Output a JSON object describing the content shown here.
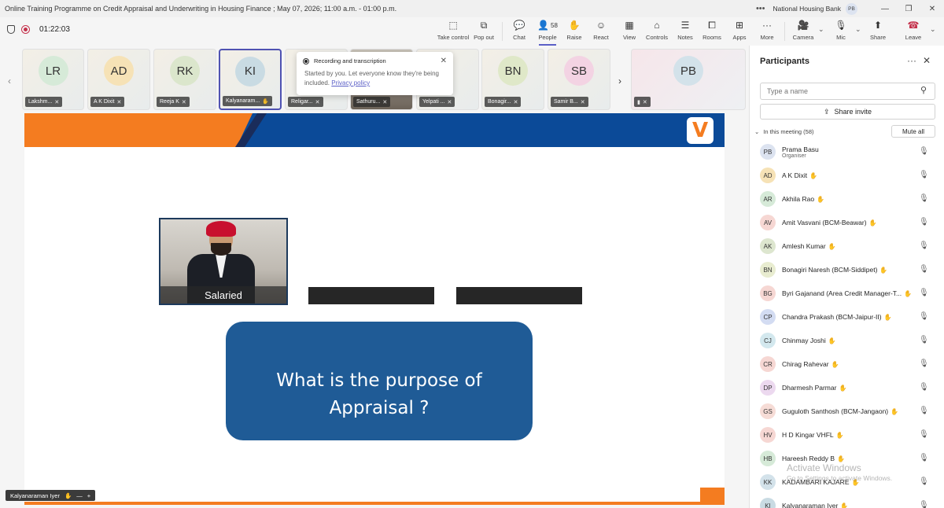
{
  "window": {
    "title": "Online Training Programme on Credit Appraisal and Underwriting in Housing Finance ; May 07, 2026; 11:00 a.m. - 01:00 p.m.",
    "org": "National Housing Bank",
    "user_initials": "PB",
    "more_glyph": "•••",
    "minimize": "—",
    "restore": "❐",
    "close": "✕"
  },
  "toolbar": {
    "timer": "01:22:03",
    "take_control": "Take control",
    "pop_out": "Pop out",
    "chat": "Chat",
    "people": "People",
    "people_count": "58",
    "raise": "Raise",
    "react": "React",
    "view": "View",
    "controls": "Controls",
    "notes": "Notes",
    "rooms": "Rooms",
    "apps": "Apps",
    "more": "More",
    "camera": "Camera",
    "mic": "Mic",
    "share": "Share",
    "leave": "Leave"
  },
  "tiles": [
    {
      "initials": "LR",
      "label": "Lakshm...",
      "color": "#d6ead8"
    },
    {
      "initials": "AD",
      "label": "A K Dixit",
      "color": "#f6e2b6"
    },
    {
      "initials": "RK",
      "label": "Reeja K",
      "color": "#dbe6cc"
    },
    {
      "initials": "KI",
      "label": "Kalyanaram...",
      "color": "#c9dbe3"
    },
    {
      "initials": "",
      "label": "Religar...",
      "color": ""
    },
    {
      "initials": "",
      "label": "Sathuru...",
      "color": ""
    },
    {
      "initials": "",
      "label": "Yelpati ...",
      "color": ""
    },
    {
      "initials": "BN",
      "label": "Bonagir...",
      "color": "#dfe8c8"
    },
    {
      "initials": "SB",
      "label": "Samir B...",
      "color": "#f3d3e3"
    },
    {
      "initials": "PB",
      "label": "",
      "color": "#d3e2ea"
    }
  ],
  "popup": {
    "title": "Recording and transcription",
    "body": "Started by you. Let everyone know they're being included.",
    "link": "Privacy policy"
  },
  "slide": {
    "logo": "V",
    "caption": "Salaried",
    "line1": "What is the purpose of",
    "line2": "Appraisal ?",
    "presenter": "Kalyanaraman Iyer"
  },
  "panel": {
    "title": "Participants",
    "search_placeholder": "Type a name",
    "share_invite": "Share invite",
    "in_meeting": "In this meeting (58)",
    "mute_all": "Mute all",
    "participants": [
      {
        "initials": "PB",
        "name": "Prama Basu",
        "sub": "Organiser",
        "color": "#dce3f0"
      },
      {
        "initials": "AD",
        "name": "A K Dixit",
        "sub": "",
        "color": "#f6e2b6"
      },
      {
        "initials": "AR",
        "name": "Akhila Rao",
        "sub": "",
        "color": "#d6ead8"
      },
      {
        "initials": "AV",
        "name": "Amit Vasvani (BCM-Beawar)",
        "sub": "",
        "color": "#f6d7d3"
      },
      {
        "initials": "AK",
        "name": "Amlesh Kumar",
        "sub": "",
        "color": "#dde6cf"
      },
      {
        "initials": "BN",
        "name": "Bonagiri Naresh (BCM-Siddipet)",
        "sub": "",
        "color": "#e8ecd0"
      },
      {
        "initials": "BG",
        "name": "Byri Gajanand (Area Credit Manager-T...",
        "sub": "",
        "color": "#f6d7d3"
      },
      {
        "initials": "CP",
        "name": "Chandra Prakash (BCM-Jaipur-II)",
        "sub": "",
        "color": "#d3dcf2"
      },
      {
        "initials": "CJ",
        "name": "Chinmay Joshi",
        "sub": "",
        "color": "#d3e8ee"
      },
      {
        "initials": "CR",
        "name": "Chirag Rahevar",
        "sub": "",
        "color": "#f6d7d3"
      },
      {
        "initials": "DP",
        "name": "Dharmesh Parmar",
        "sub": "",
        "color": "#ecd9ef"
      },
      {
        "initials": "GS",
        "name": "Guguloth Santhosh (BCM-Jangaon)",
        "sub": "",
        "color": "#f6dcd6"
      },
      {
        "initials": "HV",
        "name": "H D Kingar VHFL",
        "sub": "",
        "color": "#f6d7d3"
      },
      {
        "initials": "HB",
        "name": "Hareesh Reddy B",
        "sub": "",
        "color": "#d6ead8"
      },
      {
        "initials": "KK",
        "name": "KADAMBARI KAJARE",
        "sub": "",
        "color": "#d3e2ea"
      },
      {
        "initials": "KI",
        "name": "Kalyanaraman Iyer",
        "sub": "",
        "color": "#c9dbe3"
      }
    ]
  },
  "watermark": {
    "line1": "Activate Windows",
    "line2": "Go to Settings to activate Windows."
  }
}
